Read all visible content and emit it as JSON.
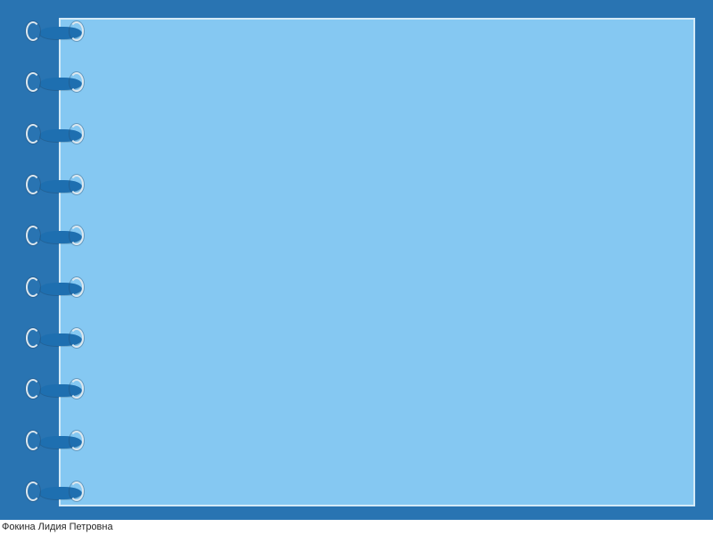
{
  "footer": {
    "author": "Фокина Лидия Петровна"
  },
  "spiral": {
    "count": 10
  }
}
